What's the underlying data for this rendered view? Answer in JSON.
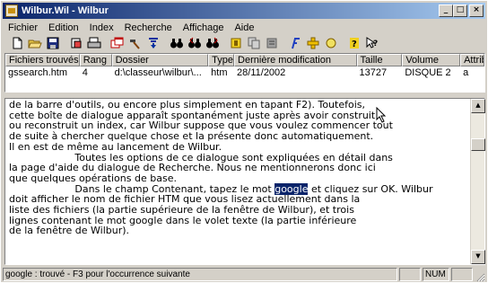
{
  "window": {
    "title": "Wilbur.Wil - Wilbur",
    "minimize": "_",
    "maximize": "□",
    "close": "×"
  },
  "menu": [
    "Fichier",
    "Edition",
    "Index",
    "Recherche",
    "Affichage",
    "Aide"
  ],
  "toolbar": {
    "buttons": [
      "new",
      "open",
      "save",
      "cut",
      "print",
      "copy-window",
      "hammer",
      "filter-down",
      "binoculars",
      "binoculars-prev",
      "binoculars-next",
      "highlight",
      "copy",
      "list",
      "italic-f",
      "add",
      "circle",
      "question",
      "help-pointer"
    ]
  },
  "results": {
    "columns": [
      "Fichiers trouvés",
      "Rang",
      "Dossier",
      "Type",
      "Dernière modification",
      "Taille",
      "Volume",
      "Attributs"
    ],
    "rows": [
      [
        "gssearch.htm",
        "4",
        "d:\\classeur\\wilbur\\...",
        "htm",
        "28/11/2002",
        "13727",
        "DISQUE 2",
        "a"
      ]
    ]
  },
  "text": {
    "lines": [
      "de la barre d'outils, ou encore plus simplement en tapant F2). Toutefois,",
      "cette boîte de dialogue apparaît spontanément juste après avoir construit",
      "ou reconstruit un index, car Wilbur suppose que vous voulez commencer tout",
      "de suite à chercher quelque chose et la présente donc automatiquement.",
      "Il en est de même au lancement de Wilbur.",
      "                     Toutes les options de ce dialogue sont expliquées en détail dans",
      "la page d'aide du dialogue de Recherche. Nous ne mentionnerons donc ici",
      "que quelques opérations de base.",
      "                     Dans le champ Contenant, tapez le mot ",
      "doit afficher le nom de fichier HTM que vous lisez actuellement dans la",
      "liste des fichiers (la partie supérieure de la fenêtre de Wilbur), et trois",
      "lignes contenant le mot google dans le volet texte (la partie inférieure",
      "de la fenêtre de Wilbur)."
    ],
    "highlight": "google",
    "after_highlight": " et cliquez sur OK. Wilbur"
  },
  "status": {
    "message": "google : trouvé - F3 pour l'occurrence suivante",
    "num": "NUM"
  }
}
